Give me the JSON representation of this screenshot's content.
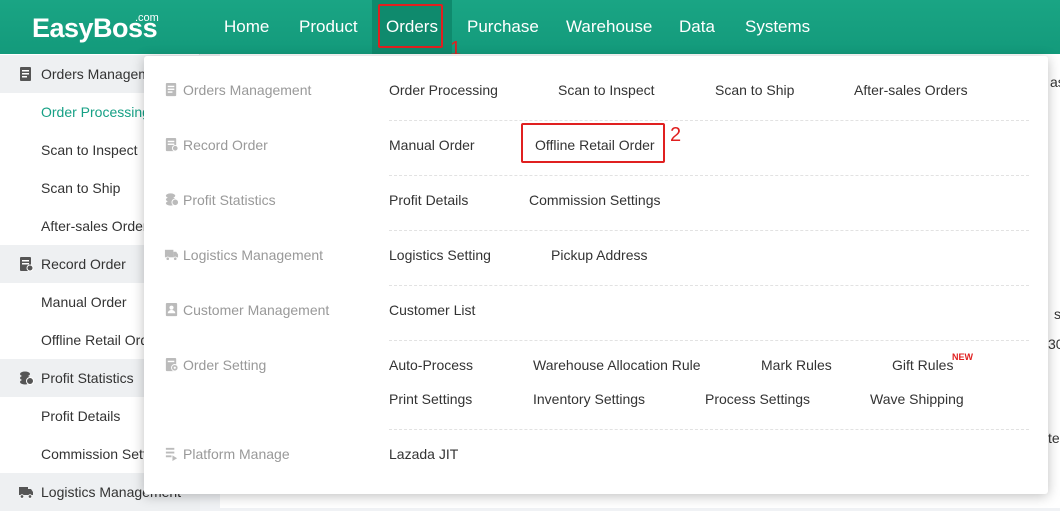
{
  "brand": {
    "name": "EasyBoss",
    "suffix": ".com"
  },
  "topnav": [
    {
      "label": "Home"
    },
    {
      "label": "Product"
    },
    {
      "label": "Orders"
    },
    {
      "label": "Purchase"
    },
    {
      "label": "Warehouse"
    },
    {
      "label": "Data"
    },
    {
      "label": "Systems"
    }
  ],
  "annotations": {
    "step1": "1",
    "step2": "2"
  },
  "sidebar": {
    "groups": [
      {
        "label": "Orders Management",
        "icon": "orders-icon"
      },
      {
        "label": "Record Order",
        "icon": "record-icon"
      },
      {
        "label": "Profit Statistics",
        "icon": "profit-icon"
      },
      {
        "label": "Logistics Management",
        "icon": "truck-icon"
      }
    ],
    "items": [
      {
        "label": "Order Processing"
      },
      {
        "label": "Scan to Inspect"
      },
      {
        "label": "Scan to Ship"
      },
      {
        "label": "After-sales Orders"
      },
      {
        "label": "Manual Order"
      },
      {
        "label": "Offline Retail Order"
      },
      {
        "label": "Profit Details"
      },
      {
        "label": "Commission Settings"
      }
    ]
  },
  "main_fragments": [
    "as",
    "s",
    "30",
    "te"
  ],
  "menu": {
    "categories": [
      {
        "label": "Orders Management",
        "icon": "orders-icon"
      },
      {
        "label": "Record Order",
        "icon": "record-icon"
      },
      {
        "label": "Profit Statistics",
        "icon": "profit-icon"
      },
      {
        "label": "Logistics Management",
        "icon": "truck-icon"
      },
      {
        "label": "Customer Management",
        "icon": "customer-icon"
      },
      {
        "label": "Order Setting",
        "icon": "setting-icon"
      },
      {
        "label": "Platform Manage",
        "icon": "platform-icon"
      }
    ],
    "links": {
      "order_processing": "Order Processing",
      "scan_to_inspect": "Scan to Inspect",
      "scan_to_ship": "Scan to Ship",
      "after_sales_orders": "After-sales Orders",
      "manual_order": "Manual Order",
      "offline_retail_order": "Offline Retail Order",
      "profit_details": "Profit Details",
      "commission_settings": "Commission Settings",
      "logistics_setting": "Logistics Setting",
      "pickup_address": "Pickup Address",
      "customer_list": "Customer List",
      "auto_process": "Auto-Process",
      "warehouse_allocation_rule": "Warehouse Allocation Rule",
      "mark_rules": "Mark Rules",
      "gift_rules": "Gift Rules",
      "print_settings": "Print Settings",
      "inventory_settings": "Inventory Settings",
      "process_settings": "Process Settings",
      "wave_shipping": "Wave Shipping",
      "lazada_jit": "Lazada JIT"
    },
    "new_badge": "NEW"
  },
  "colors": {
    "brand": "#16a085",
    "highlight": "#e02020"
  }
}
